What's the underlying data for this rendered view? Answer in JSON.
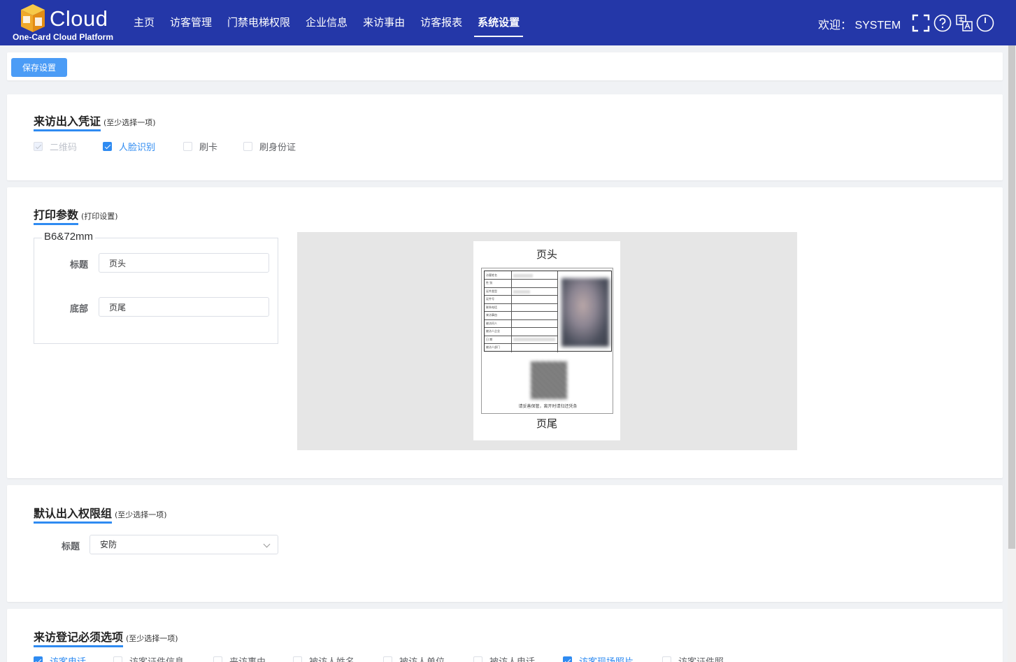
{
  "header": {
    "logo_text": "Cloud",
    "logo_subtitle": "One-Card Cloud Platform",
    "nav": [
      {
        "label": "主页"
      },
      {
        "label": "访客管理"
      },
      {
        "label": "门禁电梯权限"
      },
      {
        "label": "企业信息"
      },
      {
        "label": "来访事由"
      },
      {
        "label": "访客报表"
      },
      {
        "label": "系统设置",
        "active": true
      }
    ],
    "welcome": "欢迎： SYSTEM",
    "icons": [
      "fullscreen-icon",
      "help-icon",
      "language-icon",
      "power-icon"
    ]
  },
  "toolbar": {
    "save_label": "保存设置"
  },
  "credentials": {
    "title": "来访出入凭证",
    "subtitle": "(至少选择一项)",
    "options": [
      {
        "label": "二维码",
        "state": "disabled-checked"
      },
      {
        "label": "人脸识别",
        "state": "checked"
      },
      {
        "label": "刷卡",
        "state": "unchecked"
      },
      {
        "label": "刷身份证",
        "state": "unchecked"
      }
    ]
  },
  "print": {
    "title": "打印参数",
    "subtitle": "(打印设置)",
    "paper_size": "B6&72mm",
    "header_label": "标题",
    "header_value": "页头",
    "footer_label": "底部",
    "footer_value": "页尾",
    "preview_head": "页头",
    "preview_foot": "页尾",
    "ticket_rows": [
      "访客姓名",
      "性 别",
      "证件类型",
      "证件号",
      "联系电话",
      "来访事由",
      "被访问人",
      "被访人企业",
      "日 期",
      "被访人部门"
    ],
    "ticket_note": "请妥善保管，离开时请归还凭条"
  },
  "access_group": {
    "title": "默认出入权限组",
    "subtitle": "(至少选择一项)",
    "label": "标题",
    "value": "安防"
  },
  "required_fields": {
    "title": "来访登记必须选项",
    "subtitle": "(至少选择一项)",
    "options": [
      {
        "label": "访客电话",
        "state": "checked"
      },
      {
        "label": "访客证件信息",
        "state": "unchecked"
      },
      {
        "label": "来访事由",
        "state": "unchecked"
      },
      {
        "label": "被访人姓名",
        "state": "unchecked"
      },
      {
        "label": "被访人单位",
        "state": "unchecked"
      },
      {
        "label": "被访人电话",
        "state": "unchecked"
      },
      {
        "label": "访客现场照片",
        "state": "checked"
      },
      {
        "label": "访客证件照",
        "state": "unchecked"
      }
    ]
  },
  "colors": {
    "header_bg": "#2437a8",
    "accent": "#2f8bf1",
    "button": "#4b9cf6"
  }
}
